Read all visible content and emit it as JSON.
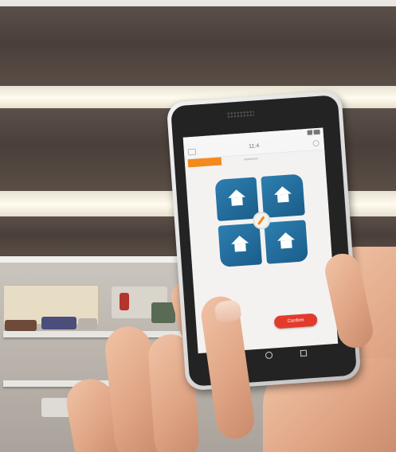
{
  "phone": {
    "status_time": "11:4",
    "app_title": "11:4",
    "confirm_label": "Confirm",
    "colors": {
      "accent": "#f28a1c",
      "tile": "#2d7fb0",
      "confirm": "#e23b2e"
    }
  }
}
